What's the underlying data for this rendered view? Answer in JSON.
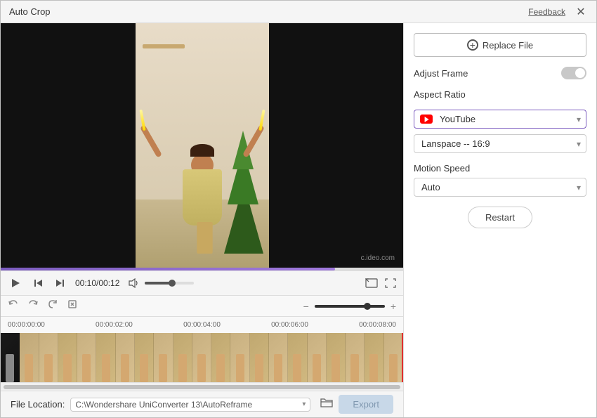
{
  "window": {
    "title": "Auto Crop",
    "feedback": "Feedback"
  },
  "right_panel": {
    "replace_file": "Replace File",
    "adjust_frame": "Adjust Frame",
    "aspect_ratio_label": "Aspect Ratio",
    "aspect_ratio_value": "YouTube",
    "aspect_ratio_sub": "Lanspace -- 16:9",
    "motion_speed_label": "Motion Speed",
    "motion_speed_value": "Auto",
    "restart_label": "Restart"
  },
  "controls": {
    "time_current": "00:10",
    "time_total": "00:12",
    "time_display": "00:10/00:12"
  },
  "timeline": {
    "marks": [
      "00:00:00:00",
      "00:00:02:00",
      "00:00:04:00",
      "00:00:06:00",
      "00:00:08:00"
    ]
  },
  "footer": {
    "file_location_label": "File Location:",
    "file_path": "C:\\Wondershare UniConverter 13\\AutoReframe",
    "export_label": "Export"
  },
  "watermark": "c.ideo.com"
}
